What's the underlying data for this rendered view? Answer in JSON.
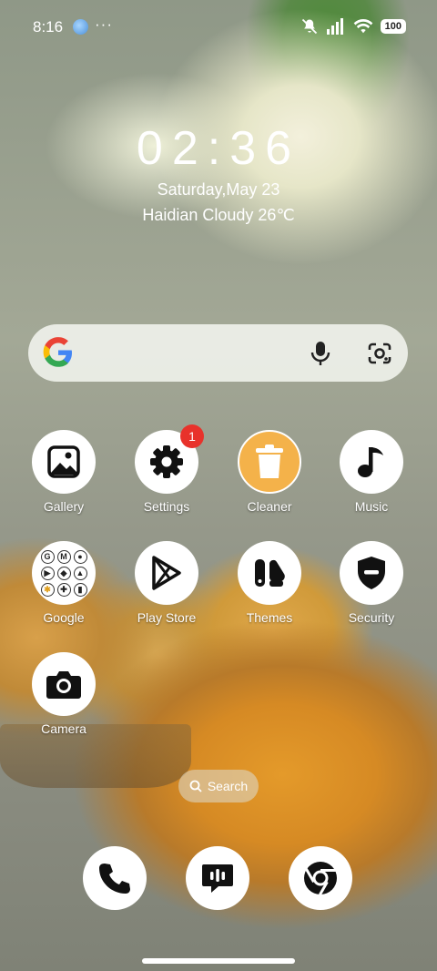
{
  "status_bar": {
    "time": "8:16",
    "more": "···",
    "battery": "100"
  },
  "clock_widget": {
    "time": "02:36",
    "date": "Saturday,May 23",
    "weather": "Haidian Cloudy 26℃"
  },
  "apps": [
    {
      "label": "Gallery",
      "icon": "gallery-icon"
    },
    {
      "label": "Settings",
      "icon": "gear-icon",
      "badge": "1"
    },
    {
      "label": "Cleaner",
      "icon": "trash-icon"
    },
    {
      "label": "Music",
      "icon": "music-note-icon"
    },
    {
      "label": "Google",
      "icon": "google-folder-icon"
    },
    {
      "label": "Play Store",
      "icon": "play-store-icon"
    },
    {
      "label": "Themes",
      "icon": "themes-icon"
    },
    {
      "label": "Security",
      "icon": "shield-icon"
    },
    {
      "label": "Camera",
      "icon": "camera-icon"
    }
  ],
  "search_pill": {
    "label": "Search"
  },
  "dock": [
    {
      "icon": "phone-icon"
    },
    {
      "icon": "messages-icon"
    },
    {
      "icon": "chrome-icon"
    }
  ],
  "google_folder_letters": [
    "G",
    "M",
    "",
    "",
    "",
    "",
    "",
    "",
    ""
  ]
}
